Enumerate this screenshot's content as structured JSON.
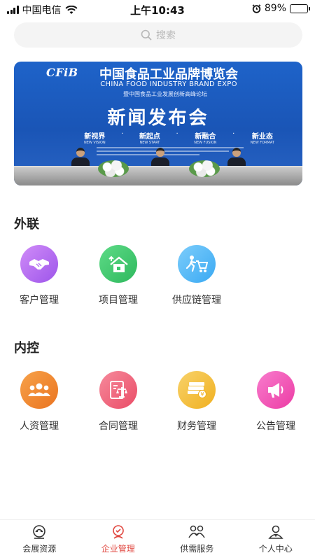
{
  "status_bar": {
    "carrier": "中国电信",
    "time": "上午10:43",
    "battery": "89%",
    "battery_level": 0.89
  },
  "search": {
    "placeholder": "搜索",
    "icon": "search-icon"
  },
  "banner": {
    "logo": "CFiB",
    "title_cn": "中国食品工业品牌博览会",
    "title_en": "CHINA FOOD INDUSTRY BRAND EXPO",
    "subtitle": "暨中国食品工业发展创新高峰论坛",
    "headline": "新闻发布会",
    "tags": [
      {
        "cn": "新视界",
        "en": "NEW VISION"
      },
      {
        "cn": "新起点",
        "en": "NEW START"
      },
      {
        "cn": "新融合",
        "en": "NEW FUSION"
      },
      {
        "cn": "新业态",
        "en": "NEW FORMAT"
      }
    ]
  },
  "sections": {
    "external": {
      "title": "外联",
      "items": [
        {
          "label": "客户管理",
          "icon": "handshake-icon",
          "color": "#b56cf0"
        },
        {
          "label": "项目管理",
          "icon": "house-growth-icon",
          "color": "#3ec86f"
        },
        {
          "label": "供应链管理",
          "icon": "cart-runner-icon",
          "color": "#4fb8f6"
        }
      ]
    },
    "internal": {
      "title": "内控",
      "items": [
        {
          "label": "人资管理",
          "icon": "people-icon",
          "color": "#f08a2c"
        },
        {
          "label": "合同管理",
          "icon": "scale-document-icon",
          "color": "#f0627a"
        },
        {
          "label": "财务管理",
          "icon": "money-stack-icon",
          "color": "#f5c23c"
        },
        {
          "label": "公告管理",
          "icon": "megaphone-icon",
          "color": "#f353b8"
        }
      ]
    }
  },
  "tabbar": {
    "items": [
      {
        "label": "会展资源",
        "icon": "expo-icon",
        "active": false
      },
      {
        "label": "企业管理",
        "icon": "enterprise-icon",
        "active": true
      },
      {
        "label": "供需服务",
        "icon": "supply-demand-icon",
        "active": false
      },
      {
        "label": "个人中心",
        "icon": "profile-icon",
        "active": false
      }
    ],
    "active_color": "#e0463f"
  }
}
